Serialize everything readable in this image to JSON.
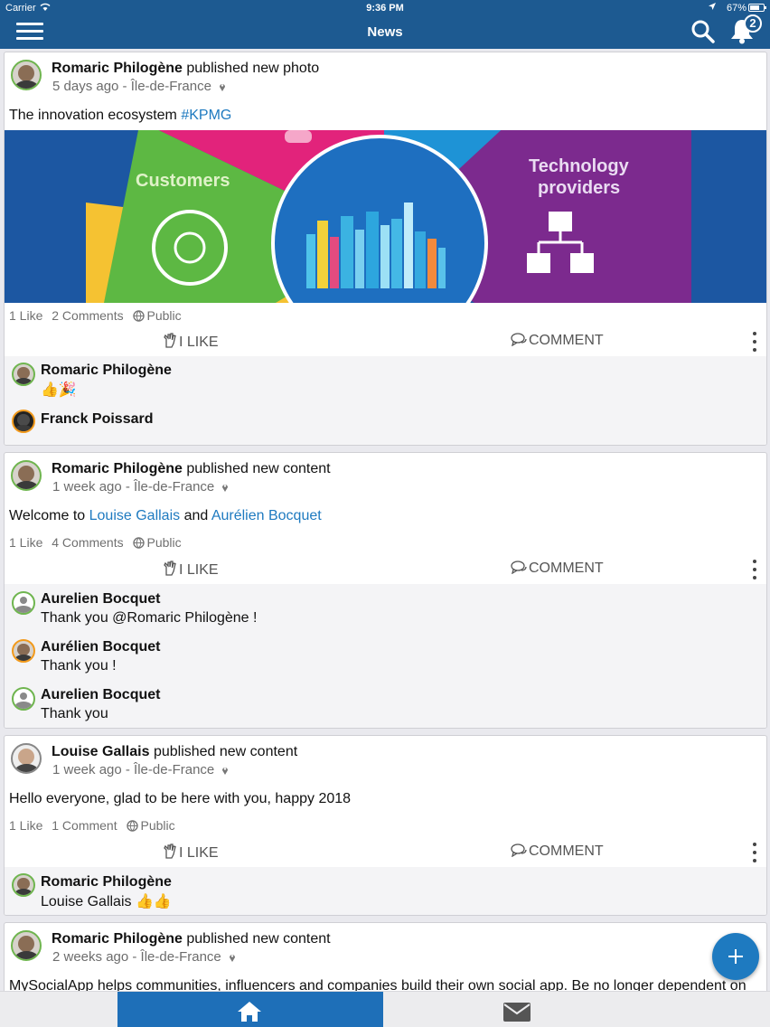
{
  "status_bar": {
    "carrier": "Carrier",
    "time": "9:36 PM",
    "battery": "67%"
  },
  "nav": {
    "title": "News",
    "notification_count": "2"
  },
  "posts": [
    {
      "author": "Romaric Philogène",
      "action": "published new photo",
      "time": "5 days ago - Île-de-France",
      "text": "The innovation ecosystem ",
      "text_link": "#KPMG",
      "photo": {
        "left_label": "Customers",
        "right_label_1": "Technology",
        "right_label_2": "providers"
      },
      "likes": "1 Like",
      "comments_count": "2 Comments",
      "visibility": "Public",
      "like_label": "I LIKE",
      "comment_label": "COMMENT",
      "comments": [
        {
          "name": "Romaric Philogène",
          "text": "👍🎉"
        },
        {
          "name": "Franck Poissard",
          "text": ""
        }
      ]
    },
    {
      "author": "Romaric Philogène",
      "action": "published new content",
      "time": "1 week ago - Île-de-France",
      "text": "Welcome to ",
      "link1": "Louise Gallais",
      "and": " and ",
      "link2": "Aurélien Bocquet",
      "likes": "1 Like",
      "comments_count": "4 Comments",
      "visibility": "Public",
      "like_label": "I LIKE",
      "comment_label": "COMMENT",
      "comments": [
        {
          "name": "Aurelien Bocquet",
          "text": "Thank you @Romaric Philogène !"
        },
        {
          "name": "Aurélien Bocquet",
          "text": "Thank you !"
        },
        {
          "name": "Aurelien Bocquet",
          "text": "Thank you"
        }
      ]
    },
    {
      "author": "Louise Gallais",
      "action": "published new content",
      "time": "1 week ago - Île-de-France",
      "text": "Hello everyone, glad to be here with you, happy 2018",
      "likes": "1 Like",
      "comments_count": "1 Comment",
      "visibility": "Public",
      "like_label": "I LIKE",
      "comment_label": "COMMENT",
      "comments": [
        {
          "name": "Romaric Philogène",
          "text": "Louise Gallais 👍👍"
        }
      ]
    },
    {
      "author": "Romaric Philogène",
      "action": "published new content",
      "time": "2 weeks ago - Île-de-France",
      "text": "MySocialApp helps communities, influencers and companies build their own social app. Be no longer dependent on"
    }
  ],
  "colors": {
    "nav": "#1d5a91",
    "link": "#1e7ac0",
    "tab_active": "#1e6fb8",
    "avatar_ring": "#6fb54f"
  }
}
